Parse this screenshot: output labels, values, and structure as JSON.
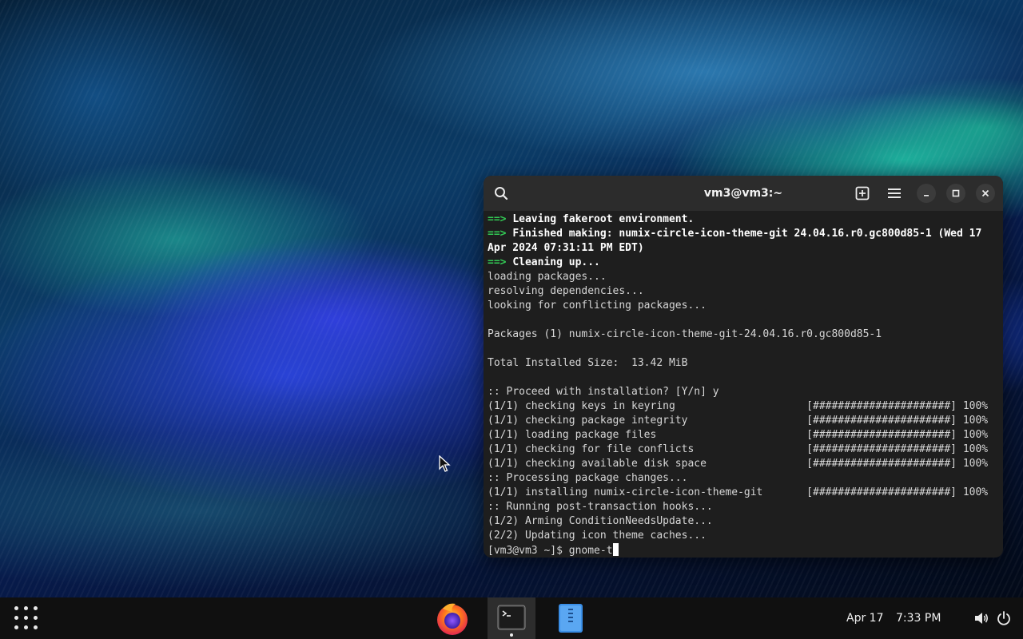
{
  "window": {
    "title": "vm3@vm3:~"
  },
  "terminal": {
    "lines": [
      {
        "arrow": "==> ",
        "text": "Leaving fakeroot environment.",
        "style": "bold"
      },
      {
        "arrow": "==> ",
        "text": "Finished making: numix-circle-icon-theme-git 24.04.16.r0.gc800d85-1 (Wed 17",
        "style": "bold"
      },
      {
        "arrow": "",
        "text": "Apr 2024 07:31:11 PM EDT)",
        "style": "bold"
      },
      {
        "arrow": "==> ",
        "text": "Cleaning up...",
        "style": "bold"
      },
      {
        "arrow": "",
        "text": "loading packages...",
        "style": "normal"
      },
      {
        "arrow": "",
        "text": "resolving dependencies...",
        "style": "normal"
      },
      {
        "arrow": "",
        "text": "looking for conflicting packages...",
        "style": "normal"
      },
      {
        "arrow": "",
        "text": "",
        "style": "normal"
      },
      {
        "arrow": "",
        "text": "Packages (1) numix-circle-icon-theme-git-24.04.16.r0.gc800d85-1",
        "style": "normal"
      },
      {
        "arrow": "",
        "text": "",
        "style": "normal"
      },
      {
        "arrow": "",
        "text": "Total Installed Size:  13.42 MiB",
        "style": "normal"
      },
      {
        "arrow": "",
        "text": "",
        "style": "normal"
      },
      {
        "arrow": "",
        "text": ":: Proceed with installation? [Y/n] y",
        "style": "normal"
      },
      {
        "arrow": "",
        "text": "(1/1) checking keys in keyring                     [######################] 100%",
        "style": "normal"
      },
      {
        "arrow": "",
        "text": "(1/1) checking package integrity                   [######################] 100%",
        "style": "normal"
      },
      {
        "arrow": "",
        "text": "(1/1) loading package files                        [######################] 100%",
        "style": "normal"
      },
      {
        "arrow": "",
        "text": "(1/1) checking for file conflicts                  [######################] 100%",
        "style": "normal"
      },
      {
        "arrow": "",
        "text": "(1/1) checking available disk space                [######################] 100%",
        "style": "normal"
      },
      {
        "arrow": "",
        "text": ":: Processing package changes...",
        "style": "normal"
      },
      {
        "arrow": "",
        "text": "(1/1) installing numix-circle-icon-theme-git       [######################] 100%",
        "style": "normal"
      },
      {
        "arrow": "",
        "text": ":: Running post-transaction hooks...",
        "style": "normal"
      },
      {
        "arrow": "",
        "text": "(1/2) Arming ConditionNeedsUpdate...",
        "style": "normal"
      },
      {
        "arrow": "",
        "text": "(2/2) Updating icon theme caches...",
        "style": "normal"
      }
    ],
    "prompt": "[vm3@vm3 ~]$ ",
    "command": "gnome-t"
  },
  "taskbar": {
    "date": "Apr 17",
    "time": "7:33 PM",
    "apps": [
      {
        "name": "Firefox",
        "icon": "firefox-icon"
      },
      {
        "name": "Terminal",
        "icon": "terminal-icon"
      },
      {
        "name": "Files",
        "icon": "files-icon"
      }
    ]
  },
  "colors": {
    "terminal_bg": "#1e1e1e",
    "titlebar_bg": "#2c2c2c",
    "arrow_green": "#33cc55",
    "taskbar_bg": "#101010"
  }
}
